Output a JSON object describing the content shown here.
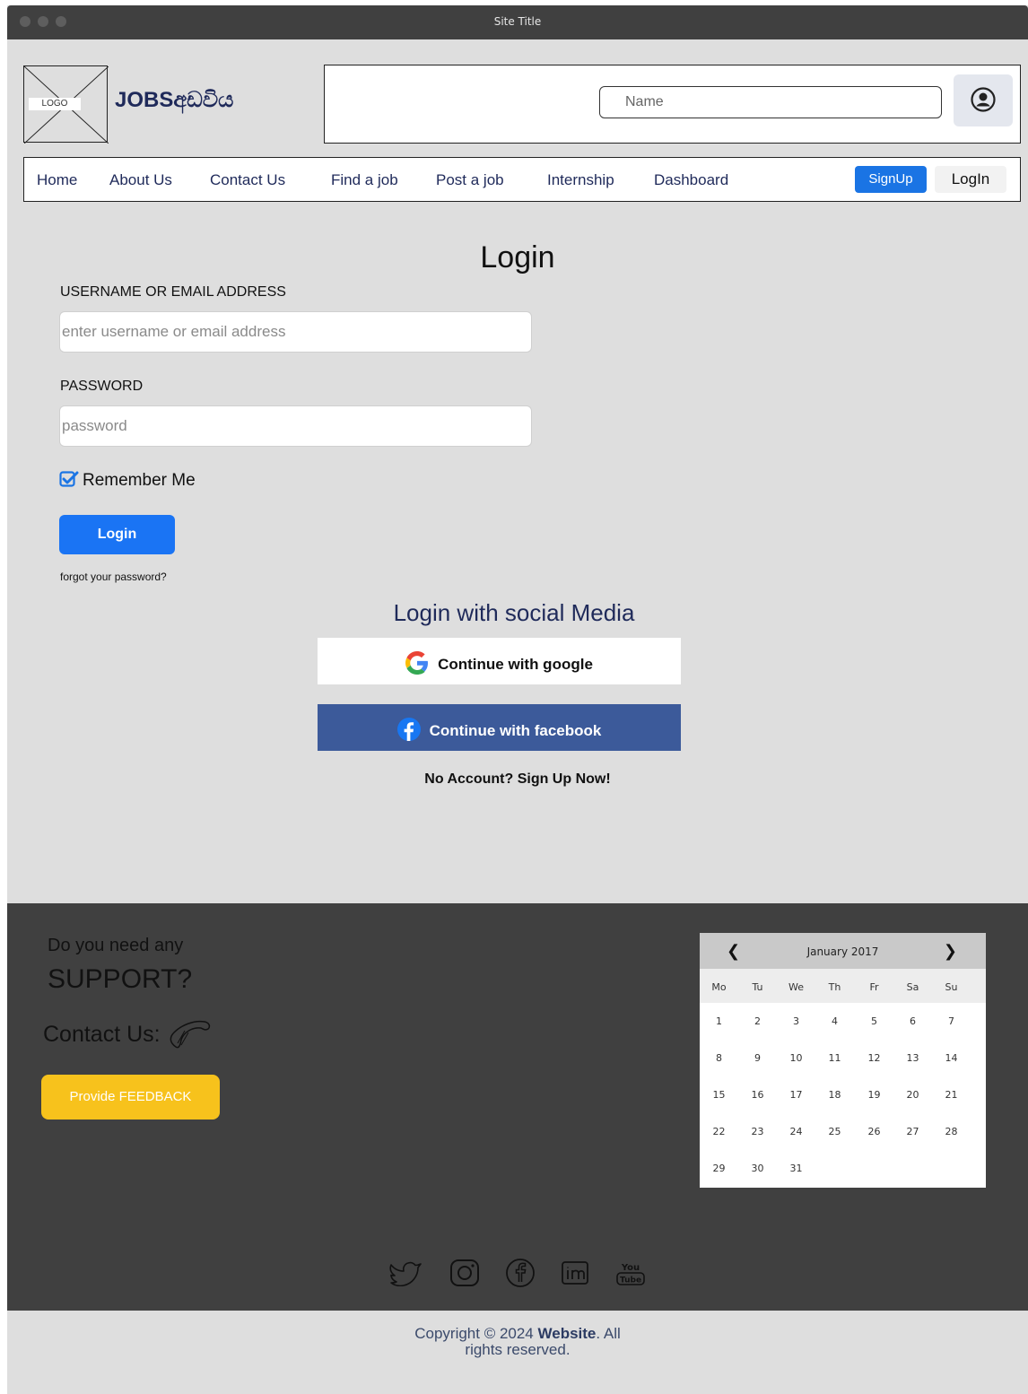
{
  "window": {
    "title": "Site Title"
  },
  "header": {
    "logo_label": "LOGO",
    "brand": "JOBSඅඩවිය",
    "search_placeholder": "Name"
  },
  "nav": {
    "items": [
      "Home",
      "About Us",
      "Contact Us",
      "Find a job",
      "Post a job",
      "Internship",
      "Dashboard"
    ],
    "signup": "SignUp",
    "login": "LogIn"
  },
  "login_form": {
    "heading": "Login",
    "username_label": "USERNAME OR EMAIL ADDRESS",
    "username_placeholder": "enter username or email address",
    "password_label": "PASSWORD",
    "password_placeholder": "password",
    "remember_me": "Remember Me",
    "remember_checked": true,
    "login_button": "Login",
    "forgot": "forgot your password?"
  },
  "social_login": {
    "heading": "Login with social Media",
    "google": "Continue with google",
    "facebook": "Continue with facebook",
    "no_account": "No Account? Sign Up Now!"
  },
  "footer": {
    "support_small": "Do you need any",
    "support_big": "SUPPORT?",
    "contact": "Contact Us:",
    "feedback_button": "Provide FEEDBACK",
    "calendar": {
      "month": "January 2017",
      "prev": "❮",
      "next": "❯",
      "weekdays": [
        "Mo",
        "Tu",
        "We",
        "Th",
        "Fr",
        "Sa",
        "Su"
      ],
      "weeks": [
        [
          "1",
          "2",
          "3",
          "4",
          "5",
          "6",
          "7"
        ],
        [
          "8",
          "9",
          "10",
          "11",
          "12",
          "13",
          "14"
        ],
        [
          "15",
          "16",
          "17",
          "18",
          "19",
          "20",
          "21"
        ],
        [
          "22",
          "23",
          "24",
          "25",
          "26",
          "27",
          "28"
        ],
        [
          "29",
          "30",
          "31",
          "",
          "",
          "",
          ""
        ]
      ]
    },
    "social_icons": [
      "twitter-icon",
      "instagram-icon",
      "facebook-icon",
      "linkedin-icon",
      "youtube-icon"
    ]
  },
  "copyright": {
    "prefix": "Copyright © 2024 ",
    "site": "Website",
    "suffix": ". All",
    "line2": "rights reserved."
  },
  "colors": {
    "primary_blue": "#1a74f4",
    "facebook_blue": "#3c5a9a",
    "feedback_yellow": "#f7c21c",
    "footer_bg": "#404040",
    "page_bg": "#dedede",
    "nav_text": "#1f2a5a"
  }
}
